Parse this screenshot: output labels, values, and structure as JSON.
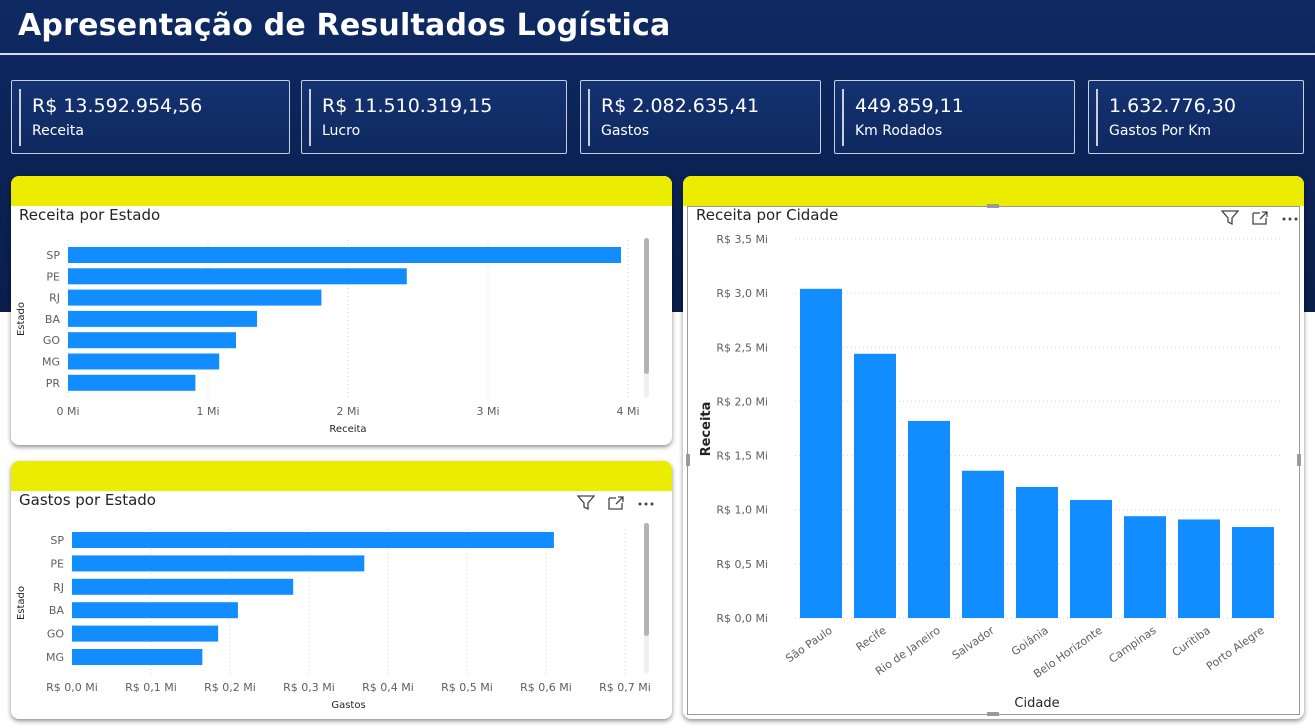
{
  "header": {
    "title": "Apresentação de Resultados Logística"
  },
  "kpis": [
    {
      "value": "R$ 13.592.954,56",
      "label": "Receita"
    },
    {
      "value": "R$ 11.510.319,15",
      "label": "Lucro"
    },
    {
      "value": "R$ 2.082.635,41",
      "label": "Gastos"
    },
    {
      "value": "449.859,11",
      "label": "Km Rodados"
    },
    {
      "value": "1.632.776,30",
      "label": "Gastos Por Km"
    }
  ],
  "colors": {
    "bar": "#118dff",
    "header_yellow": "#ecec00",
    "banner": "#0b2357"
  },
  "icons": [
    "filter-icon",
    "focus-mode-icon",
    "more-options-icon"
  ],
  "chart_data": [
    {
      "type": "bar",
      "orientation": "horizontal",
      "title": "Receita por Estado",
      "xlabel": "Receita",
      "ylabel": "Estado",
      "categories": [
        "SP",
        "PE",
        "RJ",
        "BA",
        "GO",
        "MG",
        "PR"
      ],
      "values": [
        3.95,
        2.42,
        1.81,
        1.35,
        1.2,
        1.08,
        0.91
      ],
      "xlim": [
        0,
        4
      ],
      "ticks": [
        0,
        1,
        2,
        3,
        4
      ],
      "tick_labels": [
        "0 Mi",
        "1 Mi",
        "2 Mi",
        "3 Mi",
        "4 Mi"
      ],
      "grid": true
    },
    {
      "type": "bar",
      "orientation": "horizontal",
      "title": "Gastos por Estado",
      "xlabel": "Gastos",
      "ylabel": "Estado",
      "categories": [
        "SP",
        "PE",
        "RJ",
        "BA",
        "GO",
        "MG"
      ],
      "values": [
        0.61,
        0.37,
        0.28,
        0.21,
        0.185,
        0.165
      ],
      "xlim": [
        0,
        0.7
      ],
      "ticks": [
        0,
        0.1,
        0.2,
        0.3,
        0.4,
        0.5,
        0.6,
        0.7
      ],
      "tick_labels": [
        "R$ 0,0 Mi",
        "R$ 0,1 Mi",
        "R$ 0,2 Mi",
        "R$ 0,3 Mi",
        "R$ 0,4 Mi",
        "R$ 0,5 Mi",
        "R$ 0,6 Mi",
        "R$ 0,7 Mi"
      ],
      "grid": true
    },
    {
      "type": "bar",
      "orientation": "vertical",
      "title": "Receita por Cidade",
      "xlabel": "Cidade",
      "ylabel": "Receita",
      "categories": [
        "São Paulo",
        "Recife",
        "Rio de Janeiro",
        "Salvador",
        "Goiânia",
        "Belo Horizonte",
        "Campinas",
        "Curitiba",
        "Porto Alegre"
      ],
      "values": [
        3.04,
        2.44,
        1.82,
        1.36,
        1.21,
        1.09,
        0.94,
        0.91,
        0.84
      ],
      "ylim": [
        0,
        3.5
      ],
      "ticks": [
        0,
        0.5,
        1.0,
        1.5,
        2.0,
        2.5,
        3.0,
        3.5
      ],
      "tick_labels": [
        "R$ 0,0 Mi",
        "R$ 0,5 Mi",
        "R$ 1,0 Mi",
        "R$ 1,5 Mi",
        "R$ 2,0 Mi",
        "R$ 2,5 Mi",
        "R$ 3,0 Mi",
        "R$ 3,5 Mi"
      ],
      "grid": true
    }
  ]
}
